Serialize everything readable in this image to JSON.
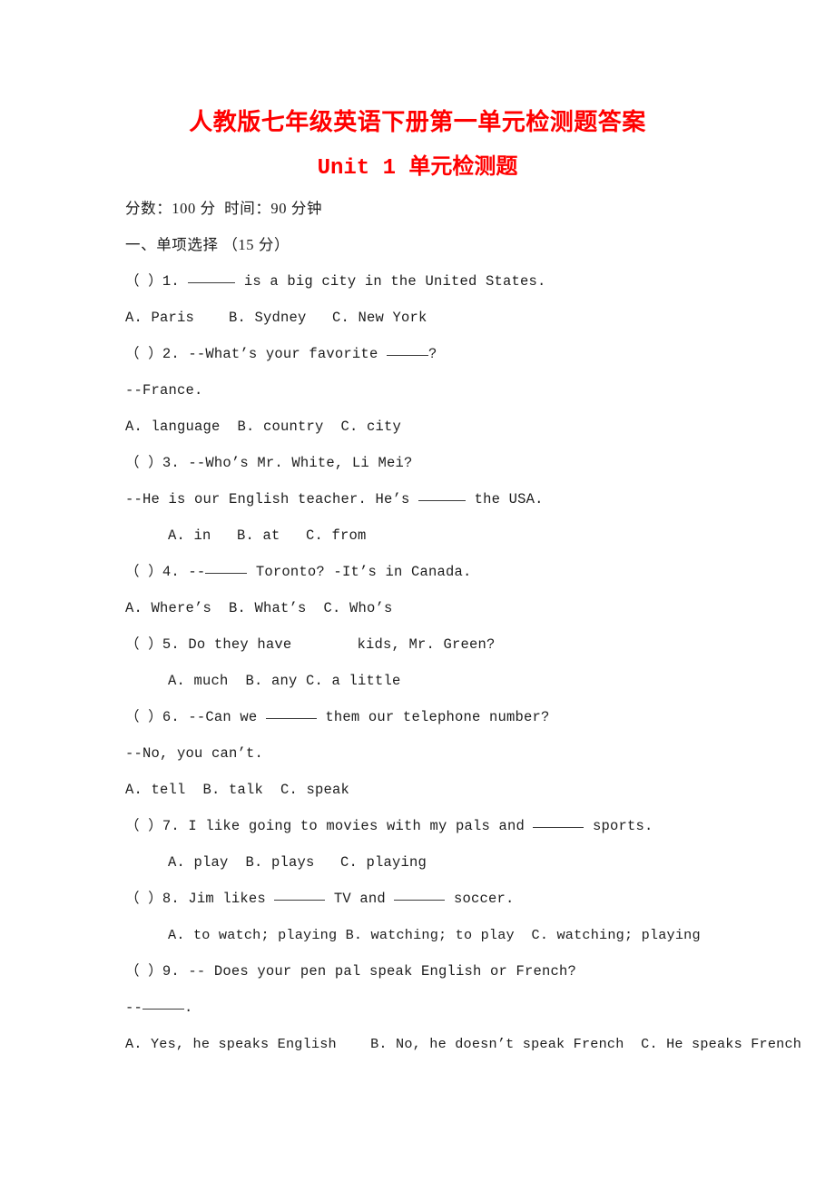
{
  "document": {
    "title": "人教版七年级英语下册第一单元检测题答案",
    "subtitle": "Unit 1 单元检测题",
    "accent_color": "#ff0000",
    "text_color": "#1d1d1d",
    "background_color": "#ffffff"
  },
  "meta": {
    "score_time_line": "分数：100 分  时间：90 分钟"
  },
  "section": {
    "heading": "一、单项选择 （15 分）"
  },
  "questions": {
    "q1": {
      "stem_a": "（ ）1. ",
      "stem_b": " is a big city in the United States.",
      "options": "A. Paris    B. Sydney   C. New York"
    },
    "q2": {
      "stem_a": "（ ）2. --What’s your favorite ",
      "stem_b": "?",
      "answer": "--France.",
      "options": "A. language  B. country  C. city"
    },
    "q3": {
      "stem": "（ ）3. --Who’s Mr. White, Li Mei?",
      "answer_a": "--He is our English teacher. He’s ",
      "answer_b": " the USA.",
      "options": "A. in   B. at   C. from"
    },
    "q4": {
      "stem_a": "（ ）4. --",
      "stem_b": " Toronto? -It’s in Canada.",
      "options": "A. Where’s  B. What’s  C. Who’s"
    },
    "q5": {
      "stem_a": "（ ）5. Do they have",
      "stem_b": "kids, Mr. Green?",
      "options": "A. much  B. any C. a little"
    },
    "q6": {
      "stem_a": "（ ）6. --Can we ",
      "stem_b": " them our telephone number?",
      "answer": "--No, you can’t.",
      "options": "A. tell  B. talk  C. speak"
    },
    "q7": {
      "stem_a": "（ ）7. I like going to movies with my pals and ",
      "stem_b": " sports.",
      "options": "A. play  B. plays   C. playing"
    },
    "q8": {
      "stem_a": "（ ）8. Jim likes ",
      "stem_b": " TV and ",
      "stem_c": " soccer.",
      "options": "A. to watch; playing B. watching; to play  C. watching; playing"
    },
    "q9": {
      "stem": "（ ）9. -- Does your pen pal speak English or French?",
      "answer_a": "--",
      "answer_b": ".",
      "options": "A. Yes, he speaks English    B. No, he doesn’t speak French  C. He speaks French"
    }
  }
}
